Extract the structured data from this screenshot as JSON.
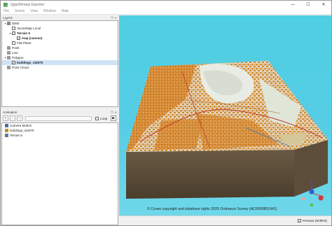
{
  "window": {
    "title": "Qgis2threejs Exporter",
    "minimize": "—",
    "maximize": "☐",
    "close": "✕"
  },
  "menu": [
    "File",
    "Scene",
    "View",
    "Window",
    "Help"
  ],
  "layers_panel": {
    "title": "Layers",
    "items": [
      {
        "label": "DEM",
        "arrow": "▾",
        "checked": true,
        "bold": false,
        "selected": false,
        "indent": 0,
        "icon": "dem-group-icon"
      },
      {
        "label": "VectorMap Local",
        "arrow": "",
        "checked": false,
        "bold": false,
        "selected": false,
        "indent": 1,
        "icon": ""
      },
      {
        "label": "Terrain 5",
        "arrow": "▾",
        "checked": true,
        "bold": true,
        "selected": false,
        "indent": 1,
        "icon": ""
      },
      {
        "label": "map (canvas)",
        "arrow": "",
        "checked": true,
        "bold": true,
        "selected": false,
        "indent": 2,
        "icon": ""
      },
      {
        "label": "Flat Plane",
        "arrow": "",
        "checked": false,
        "bold": false,
        "selected": false,
        "indent": 1,
        "icon": ""
      },
      {
        "label": "Point",
        "arrow": "",
        "checked": false,
        "bold": false,
        "selected": false,
        "indent": 0,
        "icon": "point-group-icon"
      },
      {
        "label": "Line",
        "arrow": "",
        "checked": false,
        "bold": false,
        "selected": false,
        "indent": 0,
        "icon": "line-group-icon"
      },
      {
        "label": "Polygon",
        "arrow": "▾",
        "checked": false,
        "bold": false,
        "selected": false,
        "indent": 0,
        "icon": "polygon-group-icon"
      },
      {
        "label": "buildings_ni2570",
        "arrow": "",
        "checked": true,
        "bold": true,
        "selected": true,
        "indent": 1,
        "icon": ""
      },
      {
        "label": "Point Cloud",
        "arrow": "",
        "checked": false,
        "bold": false,
        "selected": false,
        "indent": 0,
        "icon": "pointcloud-group-icon"
      }
    ]
  },
  "animation_panel": {
    "title": "Animation",
    "loop_label": "Loop",
    "loop_checked": false,
    "play": "▶",
    "items": [
      {
        "label": "Camera Motion",
        "icon": "camera-icon"
      },
      {
        "label": "buildings_ni2570",
        "icon": "layer-icon"
      },
      {
        "label": "Terrain 5",
        "icon": "dem-icon"
      }
    ]
  },
  "viewport": {
    "attribution": "© Crown copyright and database rights 2025 Ordnance Survey (AC0000851941)"
  },
  "status": {
    "preview_label": "Preview (Shift#3)",
    "preview_checked": true
  },
  "colors": {
    "sky": "#56cde5",
    "buildings": "#d98a1c",
    "terrain": "#e9eee3",
    "selection": "#cfe3f7"
  }
}
